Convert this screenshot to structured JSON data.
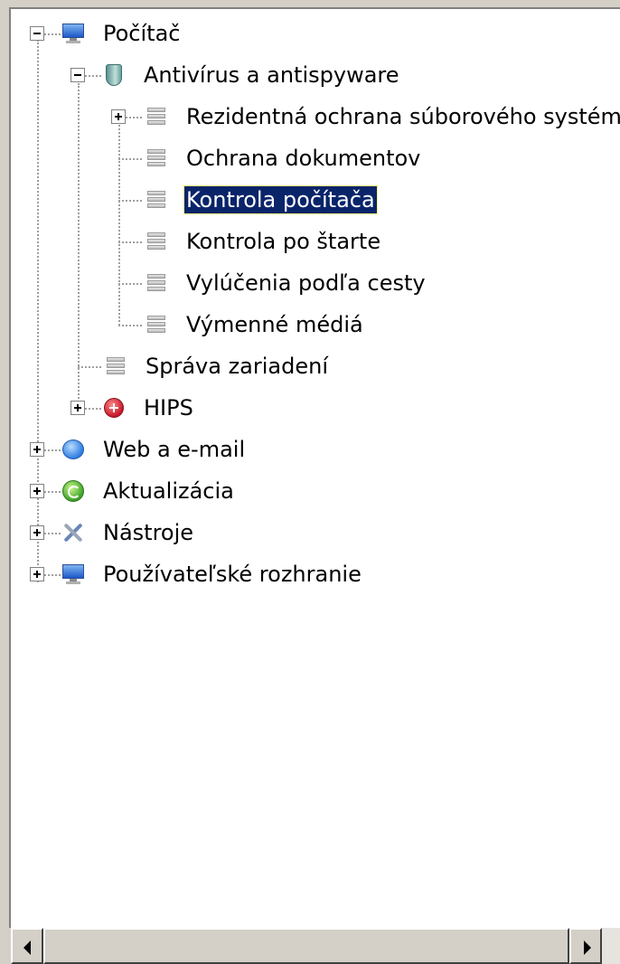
{
  "tree": {
    "pocitac": "Počítač",
    "antivirus": "Antivírus a antispyware",
    "rezidentna": "Rezidentná ochrana súborového systému",
    "ochrana_dok": "Ochrana dokumentov",
    "kontrola_pc": "Kontrola počítača",
    "kontrola_start": "Kontrola po štarte",
    "vylucenia": "Vylúčenia podľa cesty",
    "vymenne": "Výmenné médiá",
    "sprava": "Správa zariadení",
    "hips": "HIPS",
    "web": "Web a e-mail",
    "aktualizacia": "Aktualizácia",
    "nastroje": "Nástroje",
    "pouzivatelske": "Používateľské rozhranie"
  },
  "selected_node": "Kontrola počítača",
  "colors": {
    "selection_background": "#0a246a",
    "selection_text": "#ffffff",
    "window_background": "#d4d0c8"
  },
  "icons": {
    "pocitac": "monitor-icon",
    "antivirus": "shield-icon",
    "list_items": "list-icon",
    "hips": "hips-icon",
    "web": "globe-icon",
    "aktualizacia": "update-icon",
    "nastroje": "tools-icon",
    "pouzivatelske": "monitor-icon"
  }
}
